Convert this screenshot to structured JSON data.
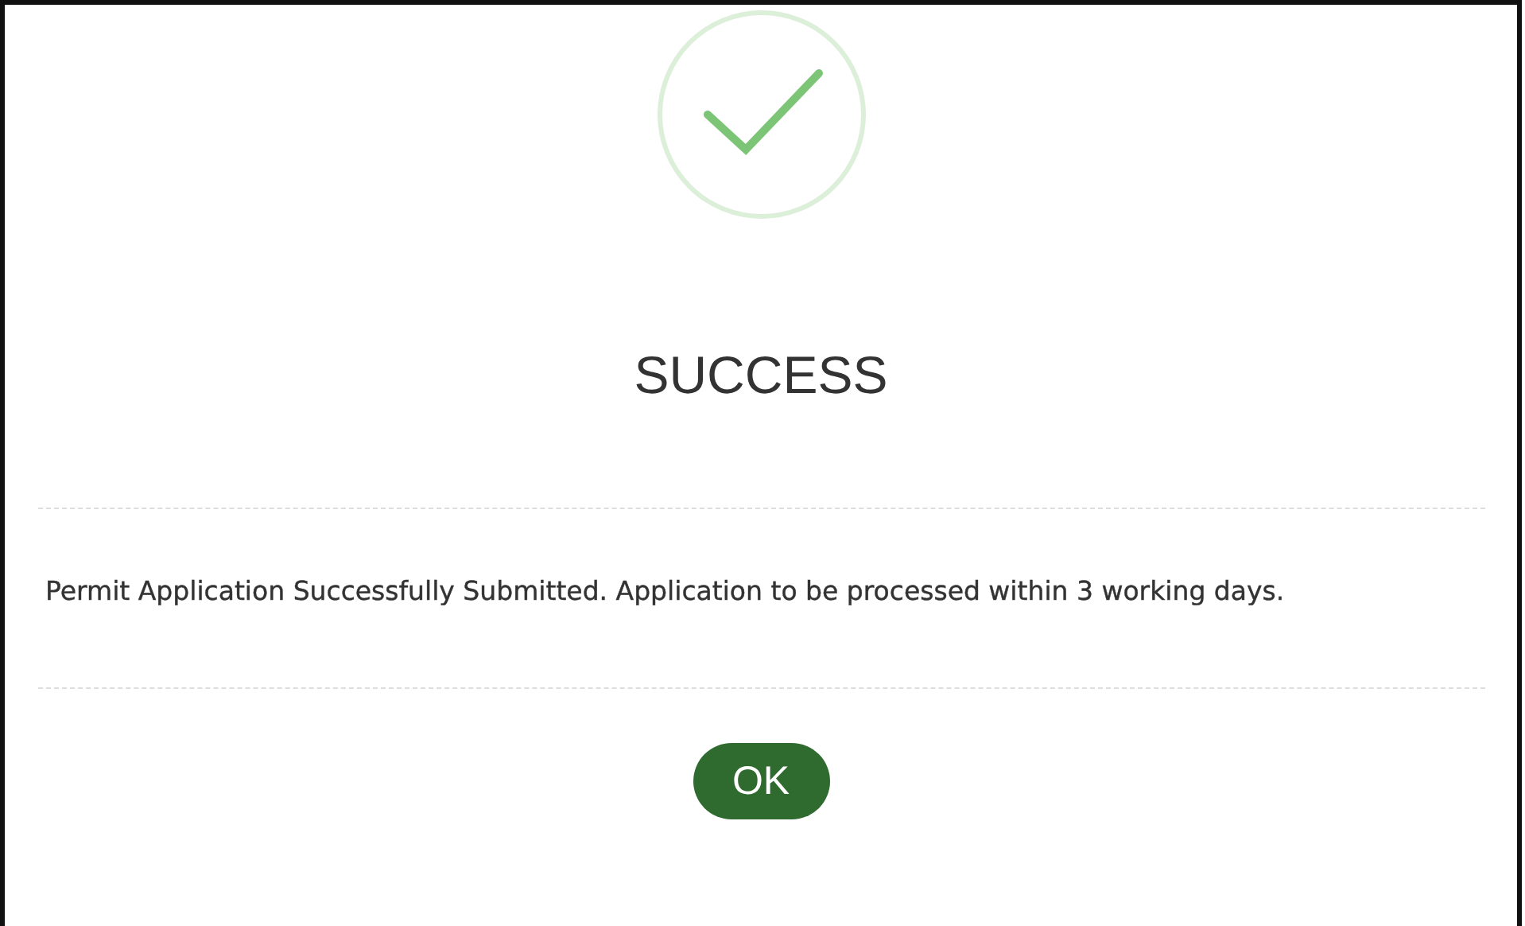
{
  "dialog": {
    "title": "SUCCESS",
    "message": "Permit Application Successfully Submitted. Application to be processed within 3 working days.",
    "button": {
      "label": "OK"
    }
  }
}
